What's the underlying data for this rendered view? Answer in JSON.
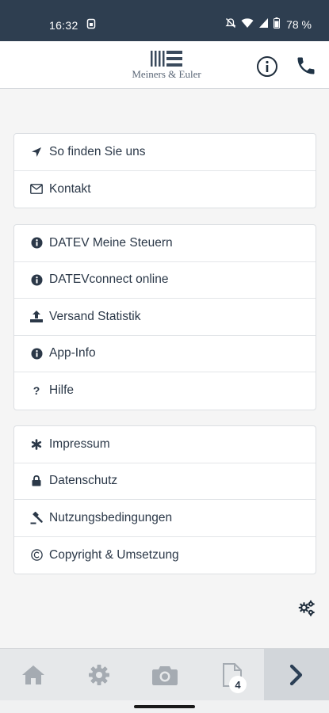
{
  "status_bar": {
    "time": "16:32",
    "battery": "78 %",
    "icons": [
      "sim-icon",
      "mute-icon",
      "wifi-icon",
      "signal-icon",
      "battery-icon"
    ]
  },
  "header": {
    "brand": "Meiners & Euler",
    "actions": [
      "info-icon",
      "phone-icon"
    ]
  },
  "groups": [
    {
      "items": [
        {
          "label": "So finden Sie uns",
          "icon": "location-arrow-icon"
        },
        {
          "label": "Kontakt",
          "icon": "envelope-icon"
        }
      ]
    },
    {
      "items": [
        {
          "label": "DATEV Meine Steuern",
          "icon": "info-circle-icon"
        },
        {
          "label": "DATEVconnect online",
          "icon": "info-circle-icon"
        },
        {
          "label": "Versand Statistik",
          "icon": "upload-icon"
        },
        {
          "label": "App-Info",
          "icon": "info-circle-icon"
        },
        {
          "label": "Hilfe",
          "icon": "question-icon"
        }
      ]
    },
    {
      "items": [
        {
          "label": "Impressum",
          "icon": "asterisk-icon"
        },
        {
          "label": "Datenschutz",
          "icon": "lock-icon"
        },
        {
          "label": "Nutzungsbedingungen",
          "icon": "gavel-icon"
        },
        {
          "label": "Copyright & Umsetzung",
          "icon": "copyright-icon"
        }
      ]
    }
  ],
  "bottom_nav": {
    "tabs": [
      "home-icon",
      "settings-icon",
      "camera-icon",
      "document-icon",
      "chevron-right-icon"
    ],
    "docs_badge": "4"
  },
  "colors": {
    "status_bar": "#2e3e50",
    "text": "#2b3848",
    "background": "#f5f5f5"
  }
}
